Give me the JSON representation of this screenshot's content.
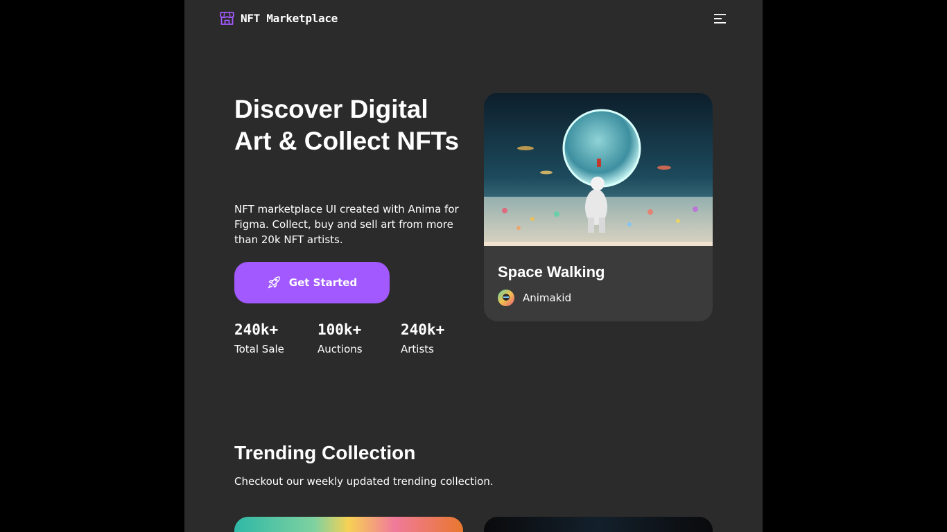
{
  "header": {
    "brand": "NFT Marketplace",
    "icons": {
      "logo": "storefront-icon",
      "menu": "hamburger-menu-icon"
    }
  },
  "hero": {
    "title": "Discover Digital Art & Collect NFTs",
    "subtitle": "NFT marketplace UI created with Anima for Figma. Collect, buy and sell art from more than 20k NFT artists.",
    "cta_label": "Get Started",
    "cta_icon": "rocket-icon",
    "stats": [
      {
        "value": "240k+",
        "label": "Total Sale"
      },
      {
        "value": "100k+",
        "label": "Auctions"
      },
      {
        "value": "240k+",
        "label": "Artists"
      }
    ]
  },
  "featured": {
    "title": "Space Walking",
    "artist": "Animakid"
  },
  "trending": {
    "title": "Trending Collection",
    "subtitle": "Checkout our weekly updated trending collection."
  },
  "colors": {
    "accent": "#a259ff",
    "background": "#2b2b2b",
    "card": "#3b3b3b",
    "outer": "#000000"
  }
}
